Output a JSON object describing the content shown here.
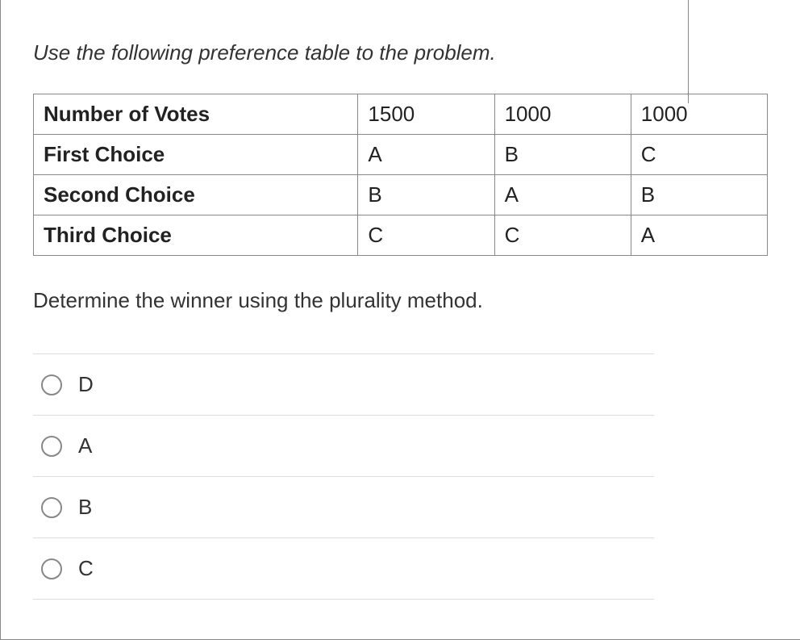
{
  "instruction": "Use the following preference table to the problem.",
  "table": {
    "rows": [
      {
        "label": "Number of Votes",
        "c1": "1500",
        "c2": "1000",
        "c3": "1000"
      },
      {
        "label": "First Choice",
        "c1": "A",
        "c2": "B",
        "c3": "C"
      },
      {
        "label": "Second Choice",
        "c1": "B",
        "c2": "A",
        "c3": "B"
      },
      {
        "label": "Third Choice",
        "c1": "C",
        "c2": "C",
        "c3": "A"
      }
    ]
  },
  "question": "Determine the winner using the plurality method.",
  "options": [
    {
      "label": "D"
    },
    {
      "label": "A"
    },
    {
      "label": "B"
    },
    {
      "label": "C"
    }
  ]
}
